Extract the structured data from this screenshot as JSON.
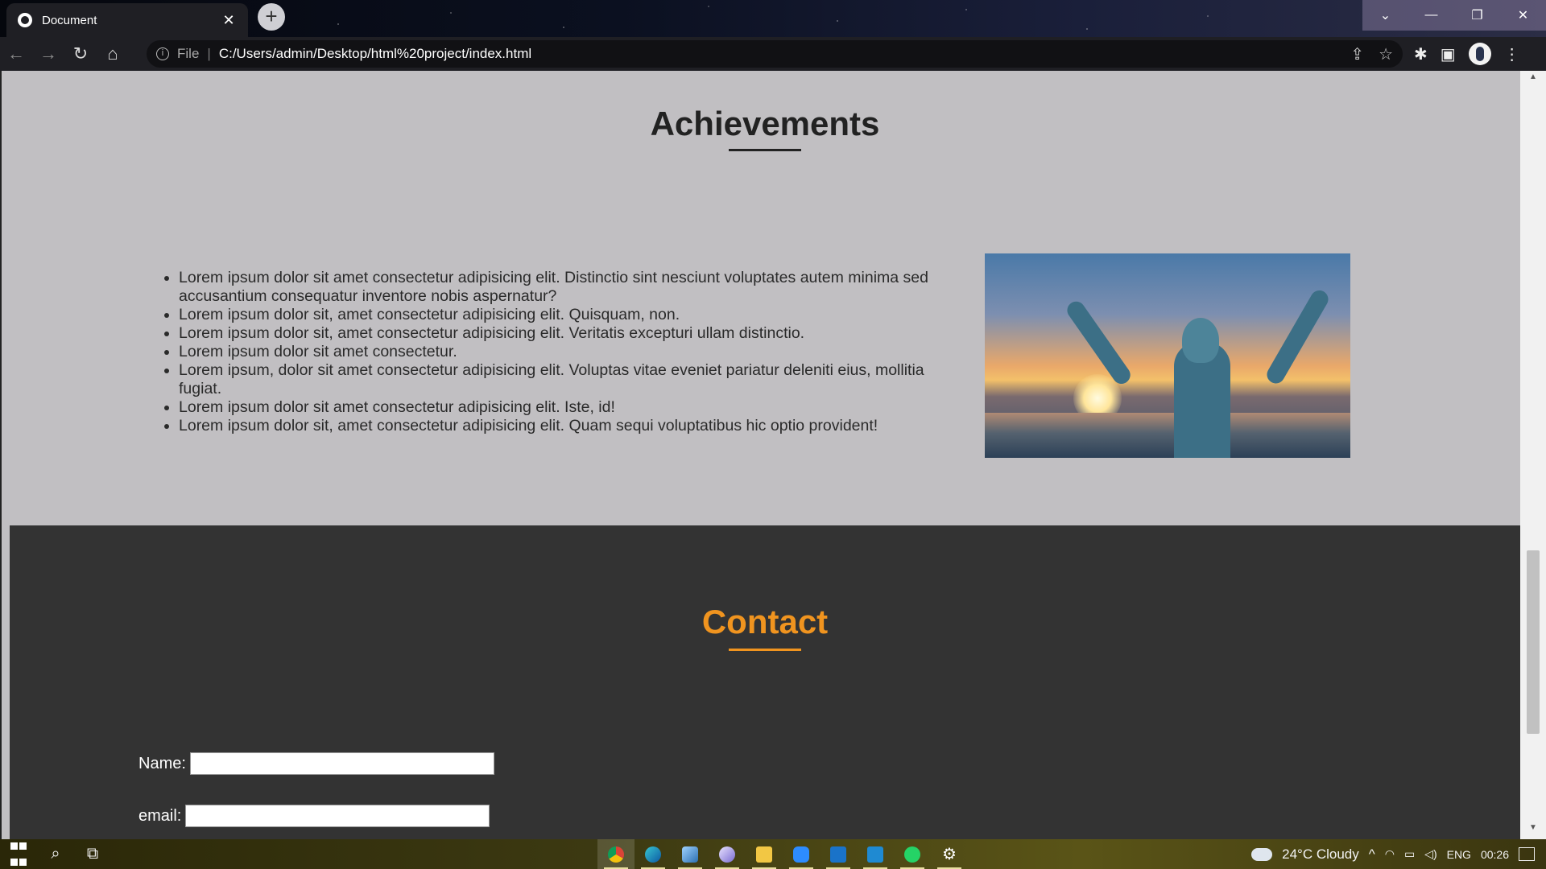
{
  "browser": {
    "tab_title": "Document",
    "tab_close": "✕",
    "new_tab": "+",
    "window_controls": [
      "⌄",
      "—",
      "❐",
      "✕"
    ],
    "nav": {
      "back": "←",
      "forward": "→",
      "reload": "↻",
      "home": "⌂"
    },
    "address": {
      "scheme": "File",
      "separator": "|",
      "url": "C:/Users/admin/Desktop/html%20project/index.html"
    },
    "omnibox_actions": [
      "⇪",
      "☆"
    ],
    "toolbar_icons": [
      "✱",
      "▣",
      "⋮"
    ]
  },
  "achievements": {
    "title": "Achievements",
    "items": [
      "Lorem ipsum dolor sit amet consectetur adipisicing elit. Distinctio sint nesciunt voluptates autem minima sed accusantium consequatur inventore nobis aspernatur?",
      "Lorem ipsum dolor sit, amet consectetur adipisicing elit. Quisquam, non.",
      "Lorem ipsum dolor sit, amet consectetur adipisicing elit. Veritatis excepturi ullam distinctio.",
      "Lorem ipsum dolor sit amet consectetur.",
      "Lorem ipsum, dolor sit amet consectetur adipisicing elit. Voluptas vitae eveniet pariatur deleniti eius, mollitia fugiat.",
      "Lorem ipsum dolor sit amet consectetur adipisicing elit. Iste, id!",
      "Lorem ipsum dolor sit, amet consectetur adipisicing elit. Quam sequi voluptatibus hic optio provident!"
    ]
  },
  "contact": {
    "title": "Contact",
    "name_label": "Name:",
    "email_label": "email:",
    "name_value": "",
    "email_value": ""
  },
  "colors": {
    "achievements_bg": "#c1bfc2",
    "contact_bg": "#333333",
    "contact_accent": "#f0941f"
  },
  "taskbar": {
    "weather": "24°C  Cloudy",
    "language": "ENG",
    "time": "00:26",
    "tray_chevron": "^",
    "apps": [
      "chrome-icon",
      "edge-icon",
      "app-icon",
      "feather-icon",
      "file-explorer-icon",
      "zoom-icon",
      "mail-icon",
      "vscode-icon",
      "whatsapp-icon",
      "settings-icon"
    ]
  }
}
